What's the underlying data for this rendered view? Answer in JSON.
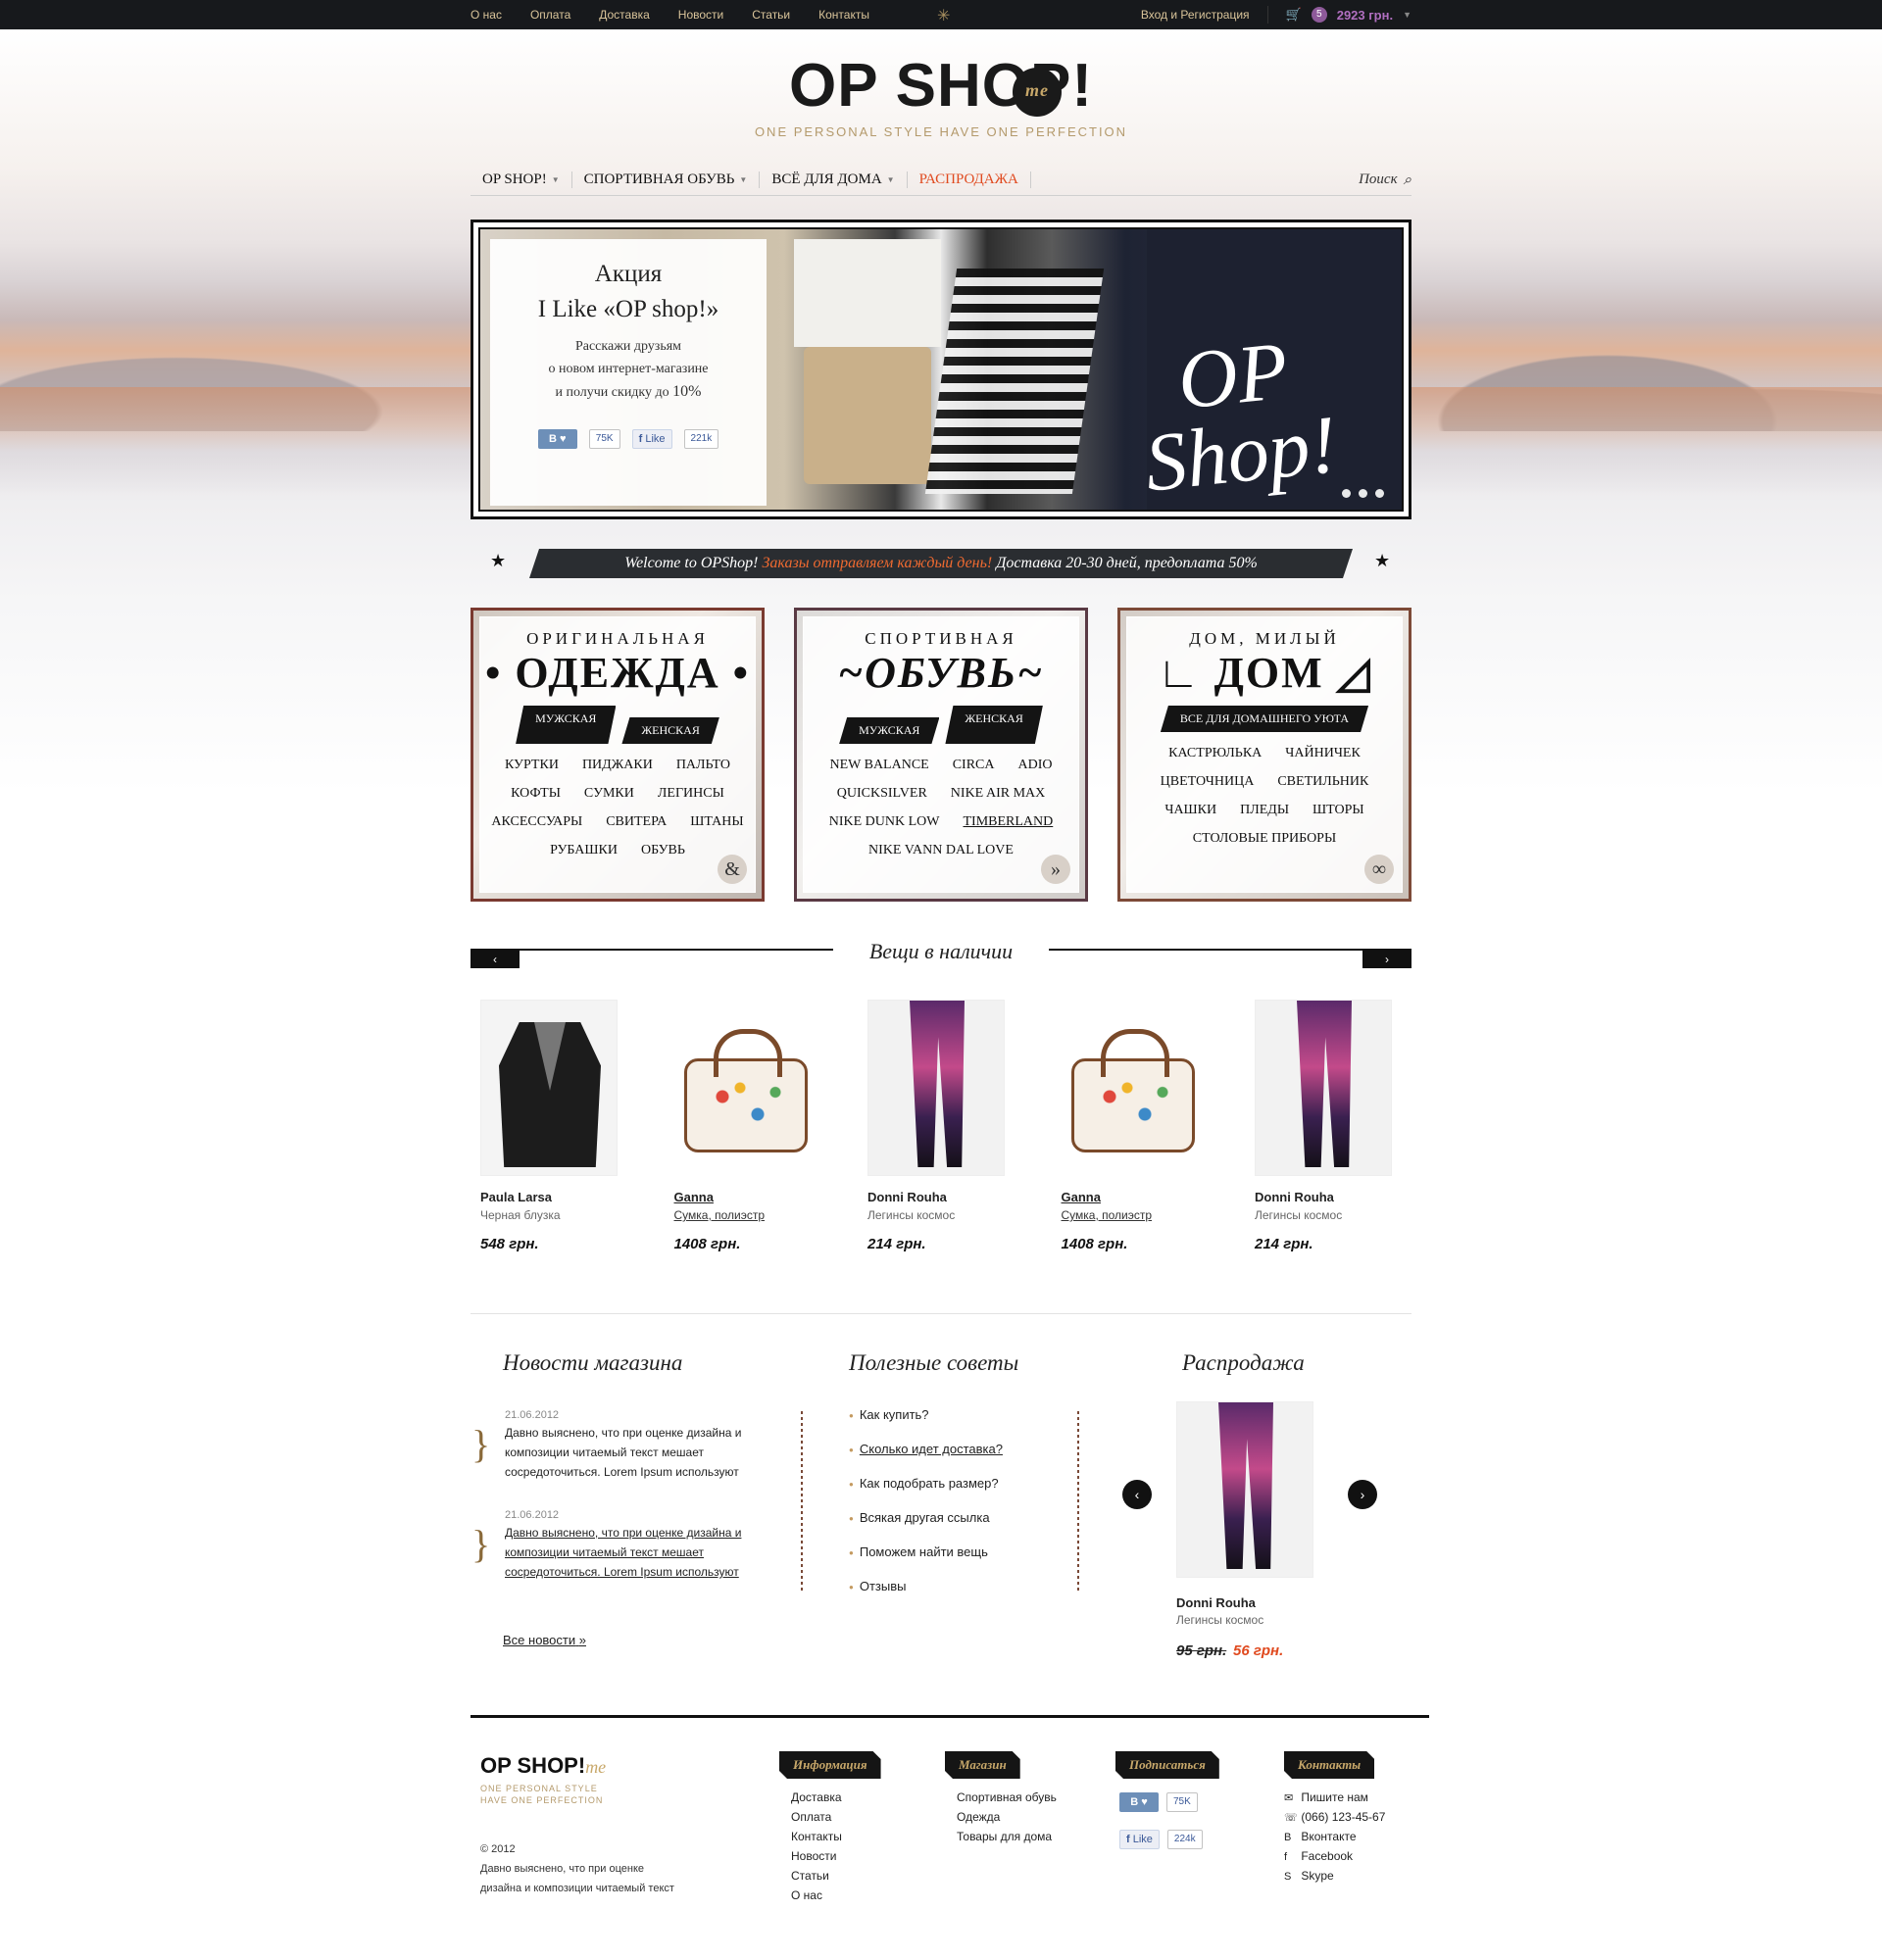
{
  "topbar": {
    "nav": [
      "О нас",
      "Оплата",
      "Доставка",
      "Новости",
      "Статьи",
      "Контакты"
    ],
    "login": "Вход и Регистрация",
    "cart_count": "5",
    "cart_total": "2923 грн."
  },
  "logo": {
    "title": "OP SHOP!",
    "me": "me",
    "tagline": "ONE PERSONAL STYLE HAVE ONE PERFECTION"
  },
  "mainnav": {
    "items": [
      "OP SHOP!",
      "СПОРТИВНАЯ ОБУВЬ",
      "ВСЁ ДЛЯ ДОМА"
    ],
    "sale": "РАСПРОДАЖА",
    "search": "Поиск"
  },
  "banner": {
    "promo_title_1": "Акция",
    "promo_title_2": "I Like «OP shop!»",
    "promo_text_1": "Расскажи друзьям",
    "promo_text_2": "о новом интернет-магазине",
    "promo_text_3": "и получи скидку до",
    "promo_pct": "10%",
    "vk_label": "В",
    "vk_count": "75K",
    "fb_label": "Like",
    "fb_count": "221k",
    "logo_1": "OP",
    "logo_2": "Shop!"
  },
  "welcome": {
    "part1": "Welcome to OPShop!",
    "part2": "Заказы отправляем каждый день!",
    "part3": "Доставка 20-30 дней, предоплата 50%"
  },
  "categories": [
    {
      "small": "ОРИГИНАЛЬНАЯ",
      "big": "• ОДЕЖДА •",
      "tags": [
        "МУЖСКАЯ",
        "ЖЕНСКАЯ"
      ],
      "links": [
        "КУРТКИ",
        "ПИДЖАКИ",
        "ПАЛЬТО",
        "КОФТЫ",
        "СУМКИ",
        "ЛЕГИНСЫ",
        "АКСЕССУАРЫ",
        "СВИТЕРА",
        "ШТАНЫ",
        "РУБАШКИ",
        "ОБУВЬ"
      ],
      "badge": "&"
    },
    {
      "small": "СПОРТИВНАЯ",
      "big": "~ОБУВЬ~",
      "tags": [
        "МУЖСКАЯ",
        "ЖЕНСКАЯ"
      ],
      "links": [
        "NEW BALANCE",
        "CIRCA",
        "ADIO",
        "QUICKSILVER",
        "NIKE AIR MAX",
        "NIKE DUNK LOW",
        "TIMBERLAND",
        "NIKE VANN DAL LOVE"
      ],
      "badge": "»"
    },
    {
      "small": "ДОМ, МИЛЫЙ",
      "big": "∟ ДОМ ◿",
      "tags": [
        "ВСЕ ДЛЯ ДОМАШНЕГО УЮТА"
      ],
      "links": [
        "КАСТРЮЛЬКА",
        "ЧАЙНИЧЕК",
        "ЦВЕТОЧНИЦА",
        "СВЕТИЛЬНИК",
        "ЧАШКИ",
        "ПЛЕДЫ",
        "ШТОРЫ",
        "СТОЛОВЫЕ ПРИБОРЫ"
      ],
      "badge": "∞"
    }
  ],
  "stock": {
    "title": "Вещи в наличии",
    "products": [
      {
        "name": "Paula Larsa",
        "desc": "Черная блузка",
        "price": "548 грн."
      },
      {
        "name": "Ganna",
        "desc": "Сумка, полиэстр",
        "price": "1408 грн."
      },
      {
        "name": "Donni Rouha",
        "desc": "Легинсы космос",
        "price": "214 грн."
      },
      {
        "name": "Ganna",
        "desc": "Сумка, полиэстр",
        "price": "1408 грн."
      },
      {
        "name": "Donni Rouha",
        "desc": "Легинсы космос",
        "price": "214 грн."
      }
    ]
  },
  "news": {
    "title": "Новости магазина",
    "items": [
      {
        "date": "21.06.2012",
        "text": "Давно выяснено, что при оценке дизайна и композиции читаемый текст мешает сосредоточиться. Lorem Ipsum используют"
      },
      {
        "date": "21.06.2012",
        "text": "Давно выяснено, что при оценке дизайна и композиции читаемый текст мешает сосредоточиться. Lorem Ipsum используют"
      }
    ],
    "all": "Все новости",
    "all_arrow": "»"
  },
  "tips": {
    "title": "Полезные советы",
    "items": [
      "Как купить?",
      "Сколько идет доставка?",
      "Как подобрать размер?",
      "Всякая другая ссылка",
      "Поможем найти вещь",
      "Отзывы"
    ]
  },
  "sale": {
    "title": "Распродажа",
    "name": "Donni Rouha",
    "desc": "Легинсы космос",
    "old_price": "95 грн.",
    "new_price": "56 грн."
  },
  "footer": {
    "logo": "OP SHOP!",
    "me": "me",
    "tagline": "ONE PERSONAL STYLE HAVE ONE PERFECTION",
    "copy": "© 2012",
    "text": "Давно выяснено, что при оценке дизайна и композиции читаемый текст",
    "info_title": "Информация",
    "info": [
      "Доставка",
      "Оплата",
      "Контакты",
      "Новости",
      "Статьи",
      "О нас"
    ],
    "shop_title": "Магазин",
    "shop": [
      "Спортивная обувь",
      "Одежда",
      "Товары для дома"
    ],
    "subscribe_title": "Подписаться",
    "vk_label": "В",
    "vk_count": "75K",
    "fb_label": "Like",
    "fb_count": "224k",
    "contacts_title": "Контакты",
    "contacts": [
      {
        "icon": "✉",
        "label": "Пишите нам"
      },
      {
        "icon": "☏",
        "label": "(066) 123-45-67"
      },
      {
        "icon": "B",
        "label": "Вконтакте"
      },
      {
        "icon": "f",
        "label": "Facebook"
      },
      {
        "icon": "S",
        "label": "Skype"
      }
    ]
  },
  "colors": {
    "accent": "#e04a1f",
    "gold": "#c8a86a",
    "dark": "#17191c",
    "cart": "#b06fc0"
  }
}
